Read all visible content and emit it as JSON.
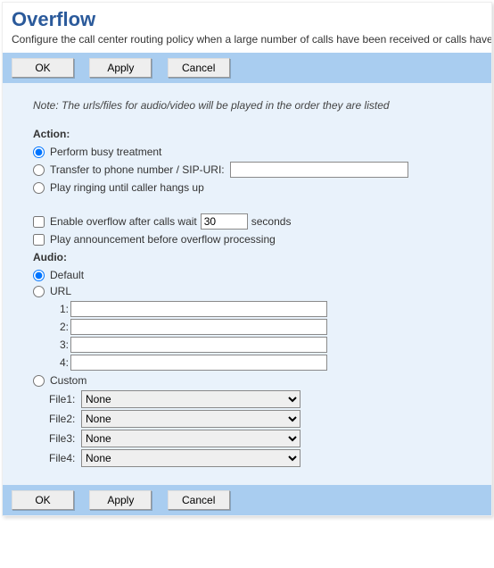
{
  "header": {
    "title": "Overflow",
    "description": "Configure the call center routing policy when a large number of calls have been received or calls have"
  },
  "buttons": {
    "ok": "OK",
    "apply": "Apply",
    "cancel": "Cancel"
  },
  "panel": {
    "note": "Note: The urls/files for audio/video will be played in the order they are listed",
    "action_label": "Action:",
    "actions": {
      "busy": "Perform busy treatment",
      "transfer": "Transfer to phone number / SIP-URI:",
      "transfer_value": "",
      "ringing": "Play ringing until caller hangs up"
    },
    "enable_overflow_label_pre": "Enable overflow after calls wait",
    "enable_overflow_value": "30",
    "enable_overflow_label_post": "seconds",
    "play_announcement": "Play announcement before overflow processing",
    "audio_label": "Audio:",
    "audio_default": "Default",
    "audio_url": "URL",
    "url_labels": [
      "1:",
      "2:",
      "3:",
      "4:"
    ],
    "url_values": [
      "",
      "",
      "",
      ""
    ],
    "audio_custom": "Custom",
    "custom_labels": [
      "File1:",
      "File2:",
      "File3:",
      "File4:"
    ],
    "custom_values": [
      "None",
      "None",
      "None",
      "None"
    ]
  }
}
